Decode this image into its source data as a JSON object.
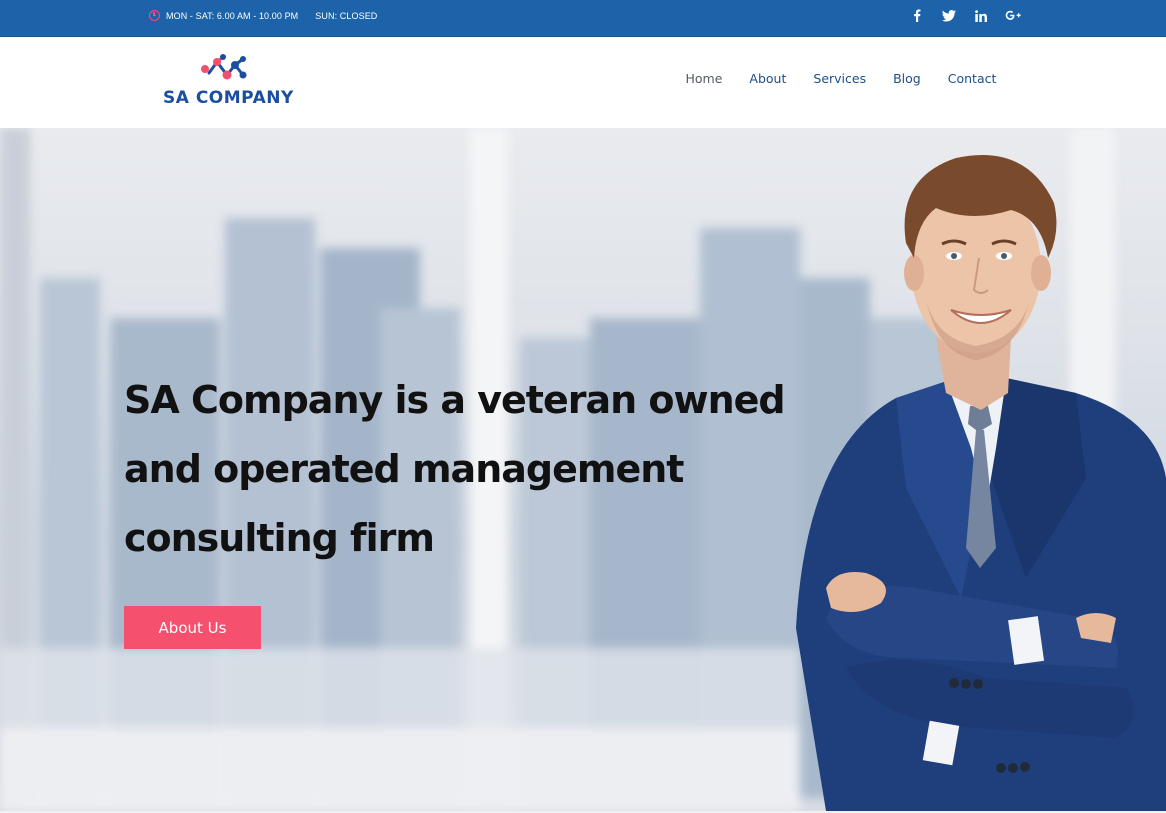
{
  "topbar": {
    "hours": "MON - SAT: 6.00 AM - 10.00 PM",
    "sunday": "SUN: CLOSED",
    "social": [
      {
        "icon": "facebook-icon",
        "glyph": "f"
      },
      {
        "icon": "twitter-icon",
        "glyph": "t"
      },
      {
        "icon": "linkedin-icon",
        "glyph": "in"
      },
      {
        "icon": "google-plus-icon",
        "glyph": "G+"
      }
    ]
  },
  "header": {
    "logo_text": "SA COMPANY",
    "nav": [
      "Home",
      "About",
      "Services",
      "Blog",
      "Contact"
    ],
    "active_nav": "Home"
  },
  "hero": {
    "title": "SA Company is a veteran owned and operated management consulting firm",
    "button_label": "About Us"
  },
  "colors": {
    "topbar": "#1c63aa",
    "accent": "#f5506e",
    "logo_blue": "#1c4ea0",
    "nav_text": "#1e4f88"
  }
}
